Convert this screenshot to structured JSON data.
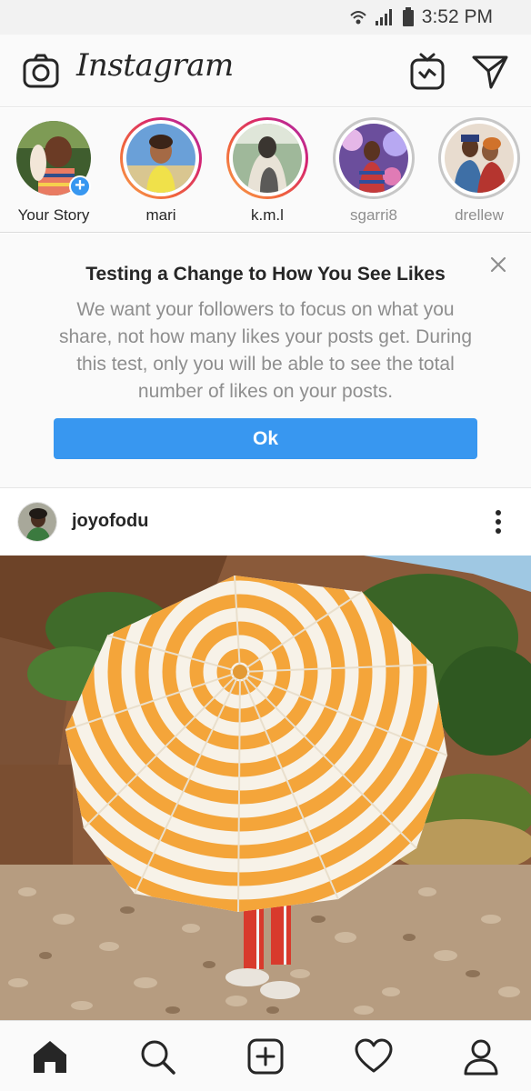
{
  "status_bar": {
    "time": "3:52 PM",
    "icons": [
      "wifi-icon",
      "signal-icon",
      "battery-icon"
    ]
  },
  "header": {
    "logo_text": "Instagram",
    "left_icon": "camera-icon",
    "right_icons": [
      "igtv-icon",
      "direct-message-icon"
    ]
  },
  "stories": [
    {
      "label": "Your Story",
      "state": "own"
    },
    {
      "label": "mari",
      "state": "unseen"
    },
    {
      "label": "k.m.l",
      "state": "unseen"
    },
    {
      "label": "sgarri8",
      "state": "seen"
    },
    {
      "label": "drellew",
      "state": "seen"
    }
  ],
  "notice": {
    "title": "Testing a Change to How You See Likes",
    "body": "We want your followers to focus on what you share, not how many likes your posts get. During this test, only you will be able to see the total number of likes on your posts.",
    "button_label": "Ok"
  },
  "post": {
    "username": "joyofodu"
  },
  "bottom_nav": {
    "items": [
      "home-icon",
      "search-icon",
      "new-post-icon",
      "activity-heart-icon",
      "profile-icon"
    ],
    "active": "home-icon"
  },
  "colors": {
    "accent_blue": "#3897f0",
    "text_primary": "#262626",
    "text_secondary": "#8e8e8e",
    "umbrella_orange": "#f4a53a"
  }
}
